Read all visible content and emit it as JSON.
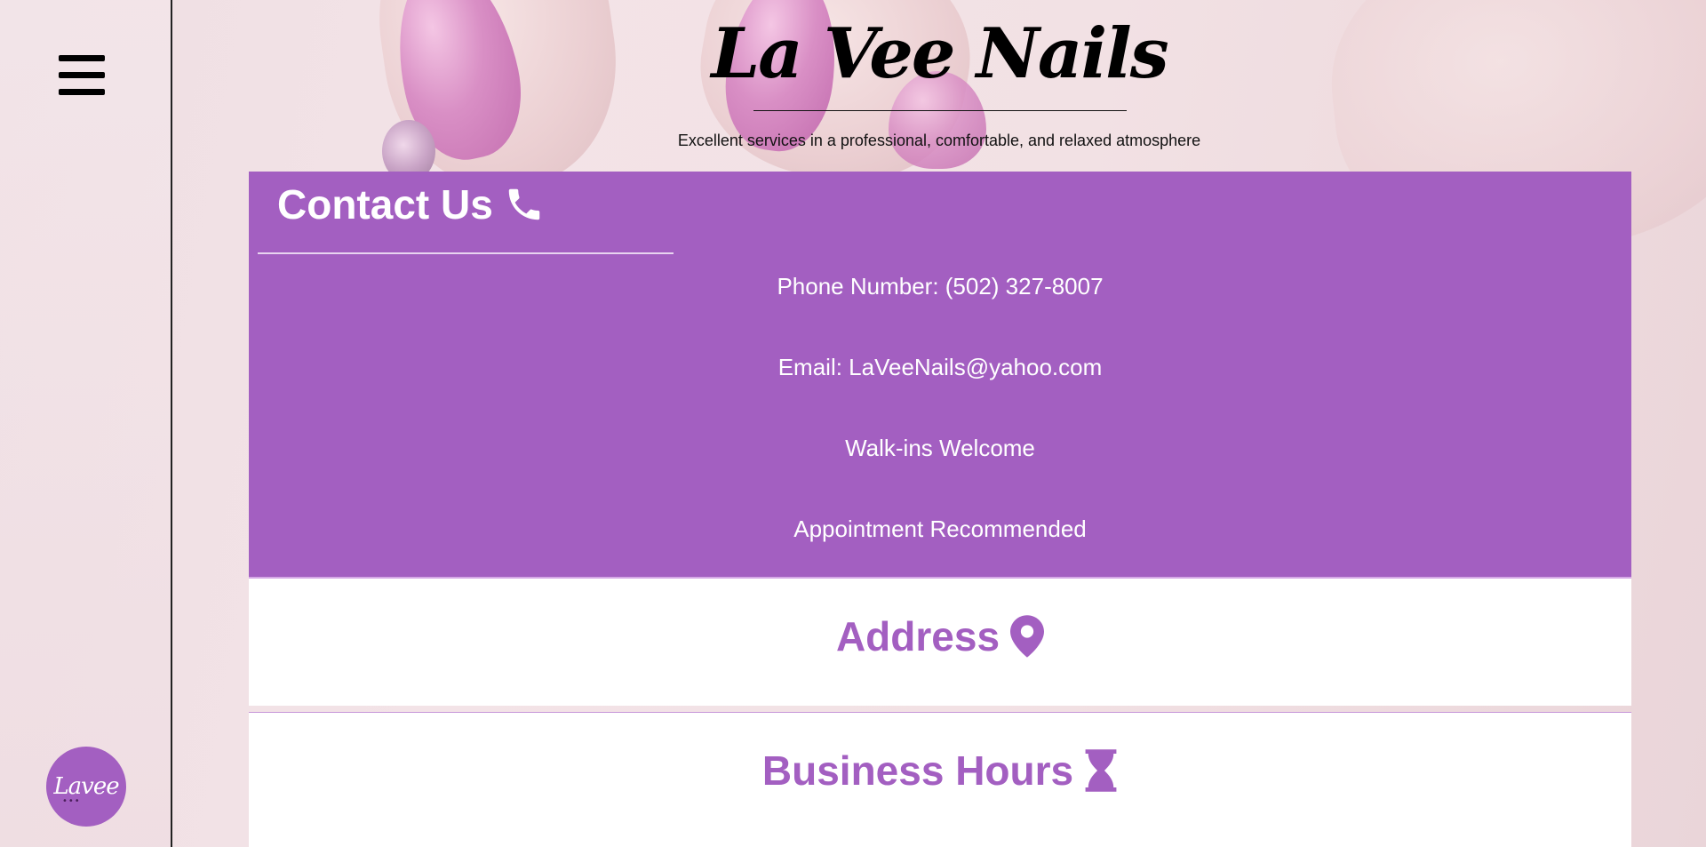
{
  "brand": {
    "name": "La Vee Nails",
    "tagline": "Excellent services in a professional, comfortable, and relaxed atmosphere"
  },
  "sidebar": {
    "menu_icon": "hamburger-menu-icon",
    "logo_text": "Lavee"
  },
  "contact": {
    "heading": "Contact Us",
    "heading_icon": "phone-icon",
    "phone": "Phone Number: (502) 327-8007",
    "email": "Email: LaVeeNails@yahoo.com",
    "walkins": "Walk-ins Welcome",
    "appointment": "Appointment Recommended"
  },
  "address": {
    "heading": "Address",
    "heading_icon": "map-pin-icon"
  },
  "hours": {
    "heading": "Business Hours",
    "heading_icon": "hourglass-icon"
  },
  "colors": {
    "accent": "#a35fc1",
    "text_on_accent": "#ffffff",
    "background": "#f2e1e4"
  }
}
